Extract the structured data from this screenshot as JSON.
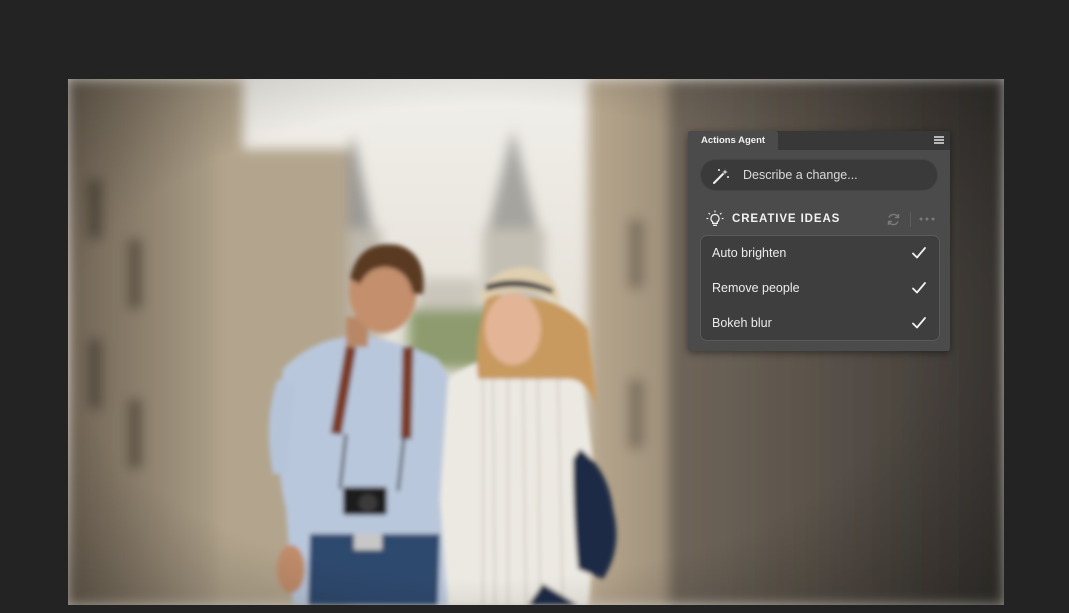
{
  "panel": {
    "tab_title": "Actions Agent",
    "menu_icon": "hamburger-menu-icon",
    "prompt_placeholder": "Describe a change...",
    "prompt_icon": "magic-wand-icon",
    "ideas_title": "CREATIVE IDEAS",
    "ideas_icon": "lightbulb-icon",
    "refresh_icon": "refresh-icon",
    "more_icon": "more-options-icon",
    "ideas": [
      {
        "label": "Auto brighten",
        "icon": "checkmark-icon"
      },
      {
        "label": "Remove people",
        "icon": "checkmark-icon"
      },
      {
        "label": "Bokeh blur",
        "icon": "checkmark-icon"
      }
    ]
  },
  "colors": {
    "app_background": "#232323",
    "panel_background": "#4b4b4b",
    "field_background": "#3a3a3a"
  }
}
